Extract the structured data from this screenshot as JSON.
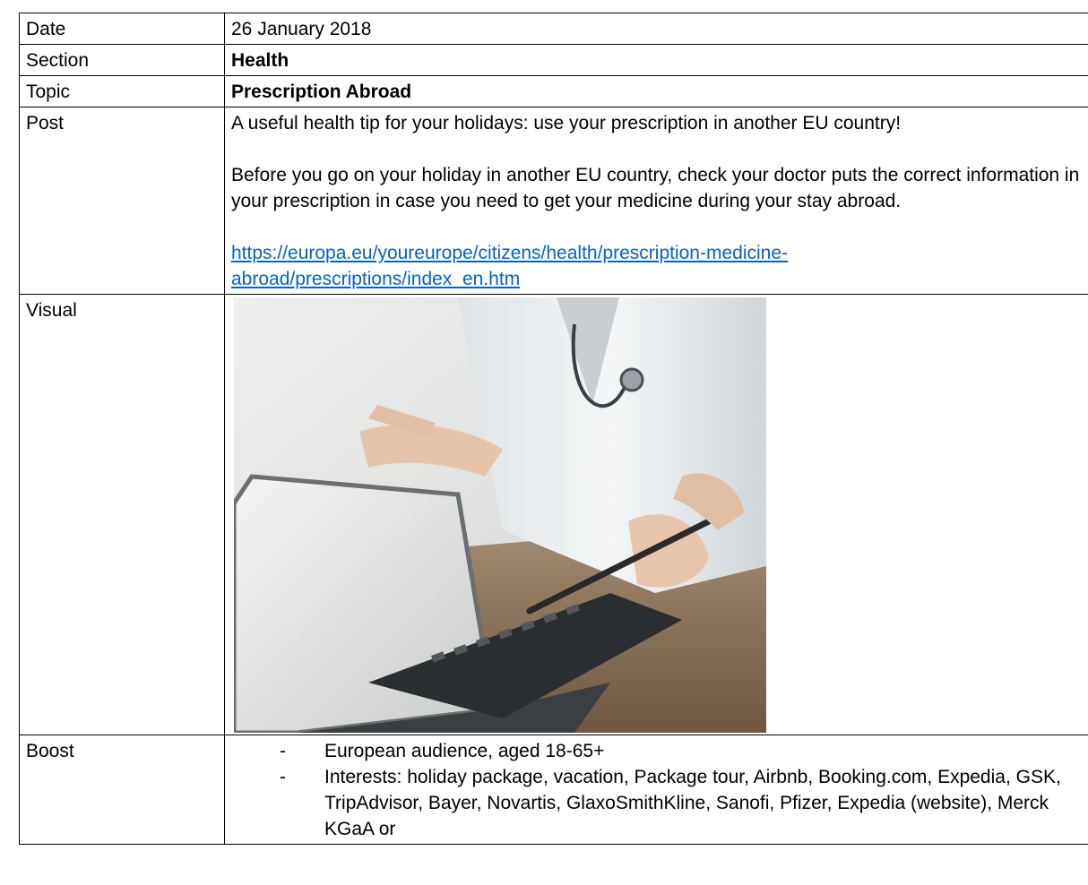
{
  "rows": {
    "date": {
      "label": "Date",
      "value": "26 January 2018"
    },
    "section": {
      "label": "Section",
      "value": "Health"
    },
    "topic": {
      "label": "Topic",
      "value": "Prescription Abroad"
    },
    "post": {
      "label": "Post",
      "paragraph1": "A useful health tip for your holidays: use your prescription in another EU country!",
      "paragraph2": "Before you go on your holiday in another EU country, check your doctor puts the correct information in your  prescription in case you need to get your medicine during your stay abroad.",
      "link_line1": "https://europa.eu/youreurope/citizens/health/prescription-medicine-",
      "link_line2": "abroad/prescriptions/index_en.htm"
    },
    "visual": {
      "label": "Visual",
      "image_description": "doctor-using-tablet-photo"
    },
    "boost": {
      "label": "Boost",
      "items": [
        "European audience, aged 18-65+",
        "Interests: holiday package, vacation, Package tour, Airbnb, Booking.com, Expedia, GSK, TripAdvisor, Bayer, Novartis, GlaxoSmithKline, Sanofi, Pfizer, Expedia (website), Merck KGaA or"
      ]
    }
  },
  "colors": {
    "link": "#0563c1",
    "border": "#000000"
  }
}
